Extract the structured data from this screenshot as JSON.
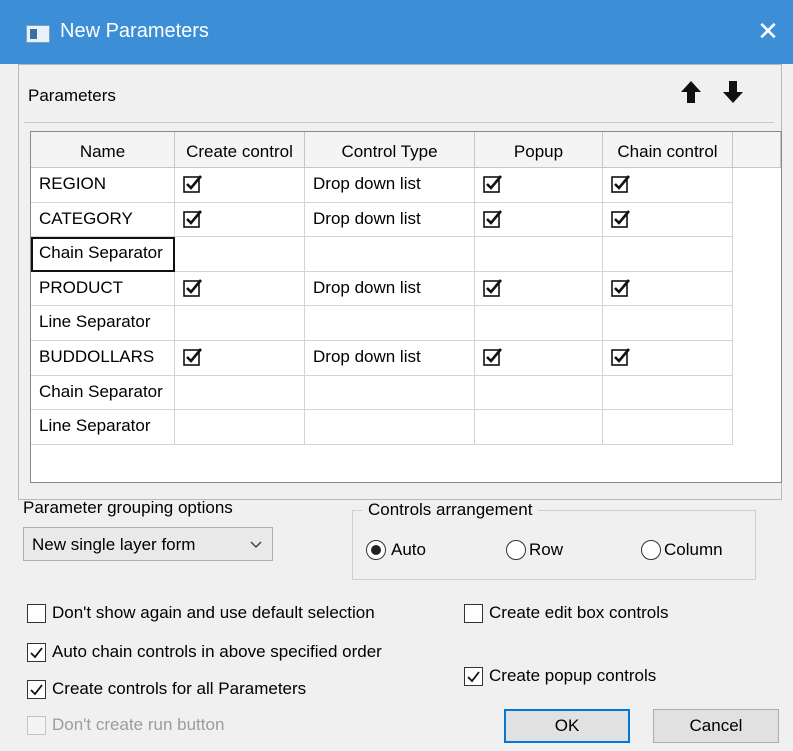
{
  "window": {
    "title": "New Parameters",
    "close_glyph": "✕"
  },
  "parameters": {
    "label": "Parameters",
    "move_up_icon": "arrow-up-icon",
    "move_down_icon": "arrow-down-icon",
    "columns": [
      "Name",
      "Create control",
      "Control Type",
      "Popup",
      "Chain control"
    ],
    "rows": [
      {
        "name": "REGION",
        "create_control": true,
        "control_type": "Drop down list",
        "popup": true,
        "chain_control": true
      },
      {
        "name": "CATEGORY",
        "create_control": true,
        "control_type": "Drop down list",
        "popup": true,
        "chain_control": true
      },
      {
        "name": "Chain Separator",
        "create_control": false,
        "control_type": "",
        "popup": false,
        "chain_control": false,
        "selected": true
      },
      {
        "name": "PRODUCT",
        "create_control": true,
        "control_type": "Drop down list",
        "popup": true,
        "chain_control": true
      },
      {
        "name": "Line Separator",
        "create_control": false,
        "control_type": "",
        "popup": false,
        "chain_control": false
      },
      {
        "name": "BUDDOLLARS",
        "create_control": true,
        "control_type": "Drop down list",
        "popup": true,
        "chain_control": true
      },
      {
        "name": "Chain Separator",
        "create_control": false,
        "control_type": "",
        "popup": false,
        "chain_control": false
      },
      {
        "name": "Line Separator",
        "create_control": false,
        "control_type": "",
        "popup": false,
        "chain_control": false
      }
    ]
  },
  "grouping": {
    "label": "Parameter grouping options",
    "selected": "New single layer form"
  },
  "arrangement": {
    "label": "Controls arrangement",
    "options": [
      "Auto",
      "Row",
      "Column"
    ],
    "selected": "Auto"
  },
  "options": {
    "dont_show": {
      "label": "Don't show again and use default selection",
      "checked": false
    },
    "auto_chain": {
      "label": "Auto chain controls in above specified order",
      "checked": true
    },
    "create_all": {
      "label": "Create controls for all Parameters",
      "checked": true
    },
    "no_run_button": {
      "label": "Don't create run button",
      "checked": false,
      "disabled": true
    },
    "edit_box": {
      "label": "Create edit box controls",
      "checked": false
    },
    "popup_controls": {
      "label": "Create popup controls",
      "checked": true
    }
  },
  "buttons": {
    "ok": "OK",
    "cancel": "Cancel"
  },
  "colors": {
    "titlebar": "#3c8fd6",
    "primary_border": "#0078d7"
  }
}
